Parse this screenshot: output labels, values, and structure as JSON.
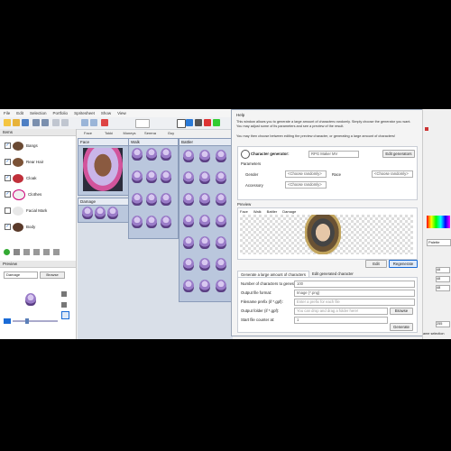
{
  "menu": [
    "File",
    "Edit",
    "Selection",
    "Portfolio",
    "Spritesheet",
    "Show",
    "View"
  ],
  "tabs": [
    "Face",
    "Tokki",
    "Moneys",
    "Serena",
    "Guy"
  ],
  "items_panel": {
    "title": "Items",
    "items": [
      {
        "label": "Bangs",
        "checked": true
      },
      {
        "label": "Rear Hair",
        "checked": true
      },
      {
        "label": "Cloak",
        "checked": true
      },
      {
        "label": "Clothes",
        "checked": true
      },
      {
        "label": "Facial Mark",
        "checked": false
      },
      {
        "label": "Body",
        "checked": true
      }
    ]
  },
  "preview_panel": {
    "title": "Preview",
    "select_value": "Damage",
    "browse_label": "Browse"
  },
  "sprite_boxes": {
    "face": "Face",
    "walk": "Walk",
    "battler": "Battler",
    "damage": "Damage"
  },
  "dialog": {
    "title": "Help",
    "desc1": "This window allows you to generate a large amount of characters randomly. Simply choose the generator you want. You may adjust some of its parameters and see a preview of the result.",
    "desc2": "You may then choose between editing the preview character, or generating a large amount of characters!",
    "generator_label": "Character generator:",
    "generator_value": "RPG Maker MV",
    "edit_generators": "Edit generators",
    "parameters_label": "Parameters",
    "gender_label": "Gender",
    "gender_value": "<Choose randomly>",
    "race_label": "Race",
    "race_value": "<Choose randomly>",
    "accessory_label": "Accessory",
    "accessory_value": "<Choose randomly>",
    "preview_label": "Preview",
    "preview_tabs": [
      "Face",
      "Walk",
      "Battler",
      "Damage"
    ],
    "edit_btn": "Edit",
    "regenerate_btn": "Regenerate",
    "mode_tabs": [
      "Generate a large amount of characters",
      "Edit generated character"
    ],
    "num_label": "Number of characters to generate:",
    "num_value": "100",
    "format_label": "Output file format:",
    "format_value": "Image (*.png)",
    "prefix_label": "Filename prefix (if *.gpf):",
    "prefix_placeholder": "Enter a prefix for each file",
    "folder_label": "Output folder (if *.gpf):",
    "folder_placeholder": "You can drop and drag a folder here!",
    "browse_btn": "Browse",
    "counter_label": "Start file counter at:",
    "counter_value": "1",
    "generate_btn": "Generate"
  },
  "right_panel": {
    "palette": "Palette",
    "numbers": [
      "48",
      "48",
      "48",
      "255"
    ],
    "footer": "ame selection"
  },
  "colors": {
    "accent": "#1a6bd6",
    "dialog_border": "#9aa6b8",
    "sprite_bg": "#bac7dd"
  }
}
